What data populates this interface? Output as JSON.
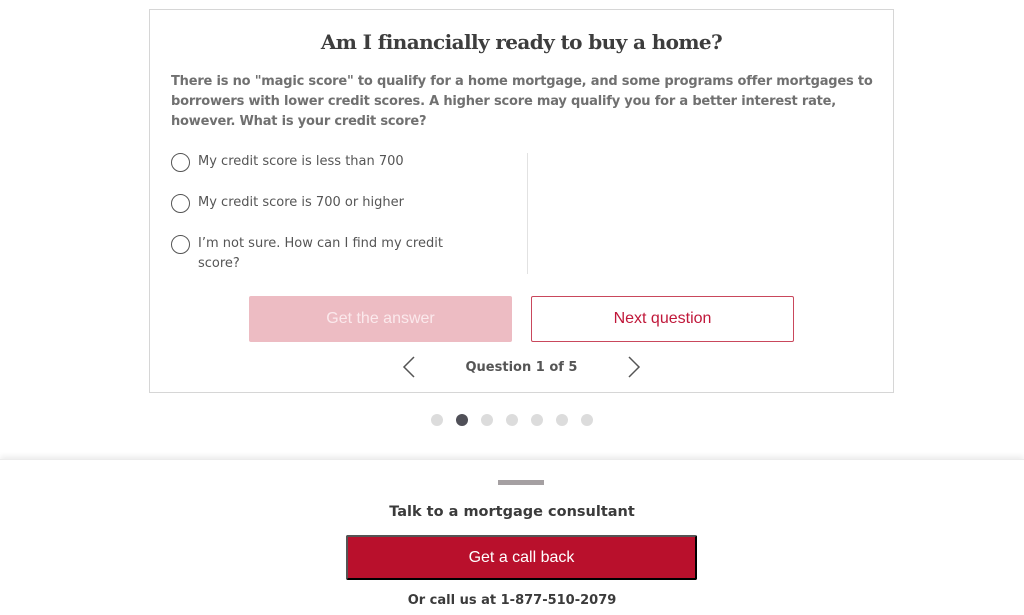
{
  "quiz": {
    "title": "Am I financially ready to buy a home?",
    "description": "There is no \"magic score\" to qualify for a home mortgage, and some programs offer mortgages to borrowers with lower credit scores. A higher score may qualify you for a better interest rate, however. What is your credit score?",
    "options": [
      {
        "label": "My credit score is less than 700",
        "selected": false
      },
      {
        "label": "My credit score is 700 or higher",
        "selected": false
      },
      {
        "label": "I’m not sure. How can I find my credit score?",
        "selected": false
      }
    ],
    "get_answer_label": "Get the answer",
    "next_question_label": "Next question",
    "pager_text": "Question 1 of 5",
    "prev_icon": "chevron-left-icon",
    "next_icon": "chevron-right-icon"
  },
  "carousel": {
    "dot_count": 7,
    "active_index": 1
  },
  "footer": {
    "heading": "Talk to a mortgage consultant",
    "call_back_label": "Get a call back",
    "call_us_text": "Or call us at 1-877-510-2079"
  },
  "colors": {
    "brand_red": "#b9102c",
    "disabled_pink": "#edbcc3",
    "active_dot": "#505058",
    "inactive_dot": "#dcdcdc"
  }
}
